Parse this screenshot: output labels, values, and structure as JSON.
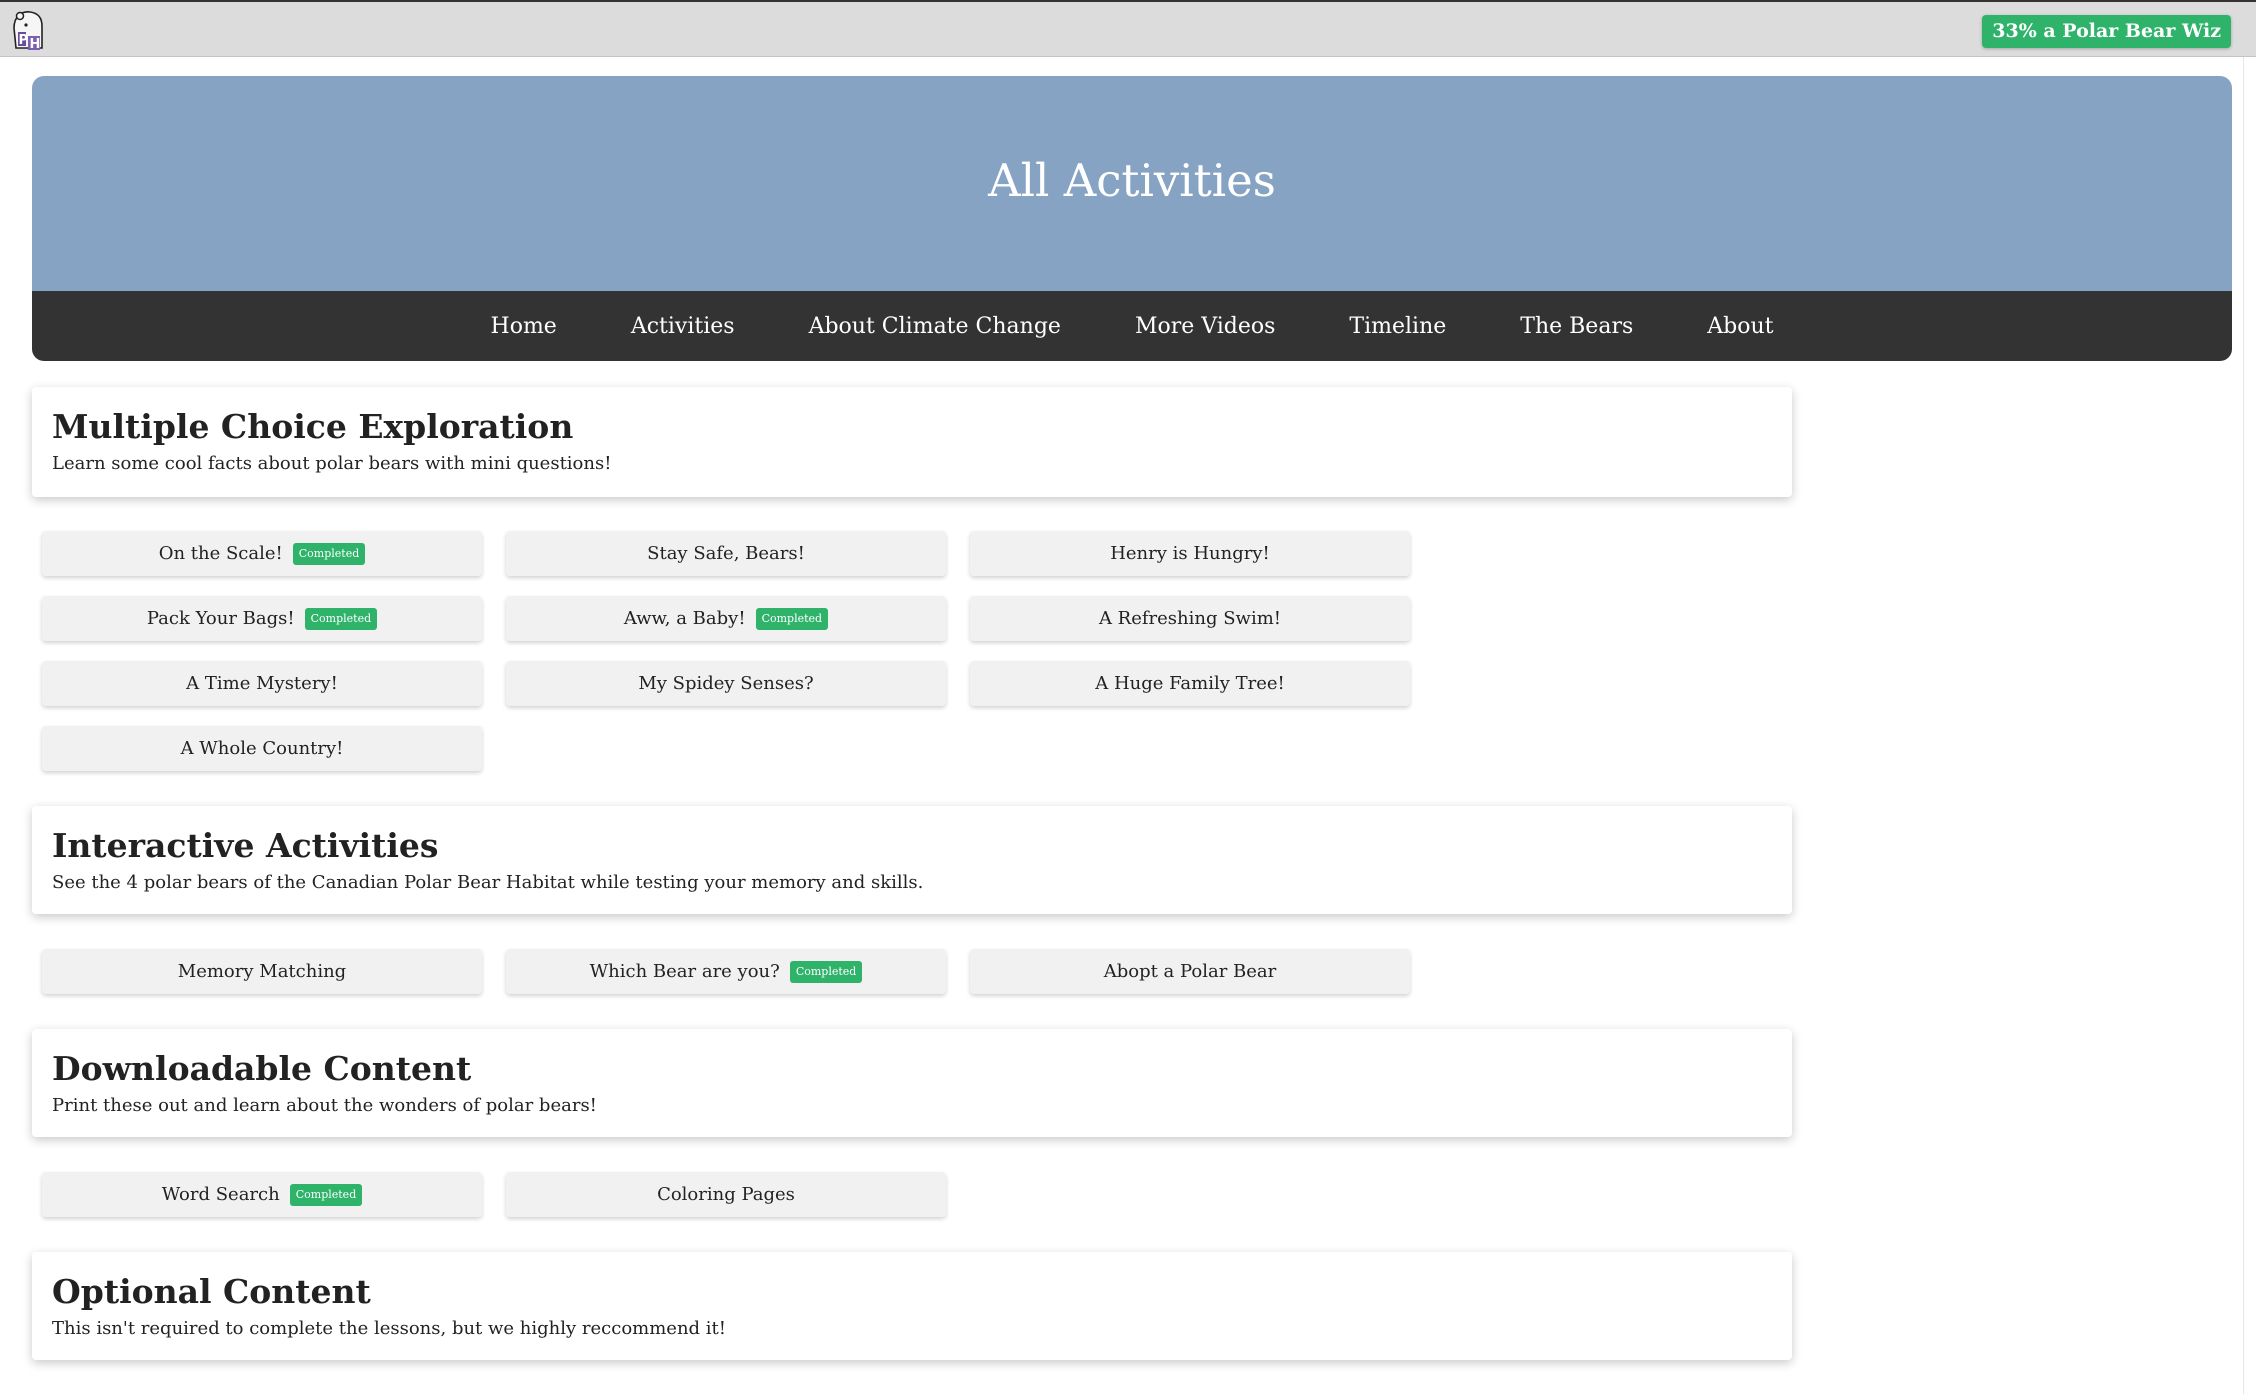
{
  "header": {
    "logo_icon": "polar-bear-habitat-logo",
    "progress_text": "33% a Polar Bear Wiz",
    "progress_percent": 33
  },
  "hero": {
    "title": "All Activities"
  },
  "nav": {
    "items": [
      "Home",
      "Activities",
      "About Climate Change",
      "More Videos",
      "Timeline",
      "The Bears",
      "About"
    ]
  },
  "sections": {
    "mc": {
      "title": "Multiple Choice Exploration",
      "description": "Learn some cool facts about polar bears with mini questions!",
      "buttons": [
        {
          "label": "On the Scale!",
          "badge": "Completed"
        },
        {
          "label": "Stay Safe, Bears!",
          "badge": ""
        },
        {
          "label": "Henry is Hungry!",
          "badge": ""
        },
        {
          "label": "Pack Your Bags!",
          "badge": "Completed"
        },
        {
          "label": "Aww, a Baby!",
          "badge": "Completed"
        },
        {
          "label": "A Refreshing Swim!",
          "badge": ""
        },
        {
          "label": "A Time Mystery!",
          "badge": ""
        },
        {
          "label": "My Spidey Senses?",
          "badge": ""
        },
        {
          "label": "A Huge Family Tree!",
          "badge": ""
        },
        {
          "label": "A Whole Country!",
          "badge": ""
        }
      ]
    },
    "interactive": {
      "title": "Interactive Activities",
      "description": "See the 4 polar bears of the Canadian Polar Bear Habitat while testing your memory and skills.",
      "buttons": [
        {
          "label": "Memory Matching",
          "badge": ""
        },
        {
          "label": "Which Bear are you?",
          "badge": "Completed"
        },
        {
          "label": "Abopt a Polar Bear",
          "badge": ""
        }
      ]
    },
    "downloadable": {
      "title": "Downloadable Content",
      "description": "Print these out and learn about the wonders of polar bears!",
      "buttons": [
        {
          "label": "Word Search",
          "badge": "Completed"
        },
        {
          "label": "Coloring Pages",
          "badge": ""
        }
      ]
    },
    "optional": {
      "title": "Optional Content",
      "description": "This isn't required to complete the lessons, but we highly reccommend it!"
    }
  },
  "colors": {
    "hero_bg": "#87a3c4",
    "nav_bg": "#333333",
    "badge_green": "#2fb36b",
    "button_bg": "#f1f1f1"
  }
}
